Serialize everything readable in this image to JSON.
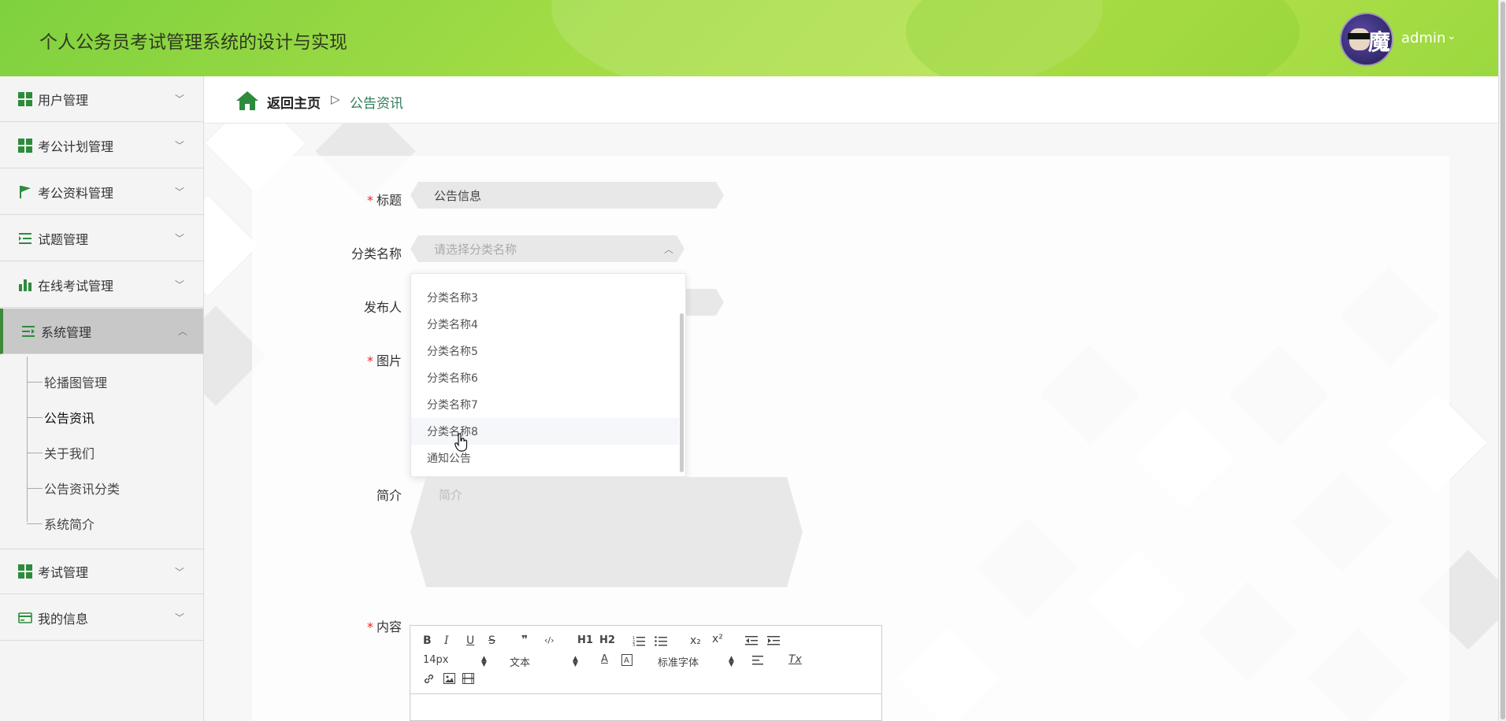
{
  "header": {
    "title": "个人公务员考试管理系统的设计与实现",
    "username": "admin",
    "avatar_glyph": "魔"
  },
  "sidebar": {
    "menus": [
      {
        "label": "用户管理",
        "icon": "grid-icon"
      },
      {
        "label": "考公计划管理",
        "icon": "grid-icon"
      },
      {
        "label": "考公资料管理",
        "icon": "flag-icon"
      },
      {
        "label": "试题管理",
        "icon": "list-indent-icon"
      },
      {
        "label": "在线考试管理",
        "icon": "bar-chart-icon"
      },
      {
        "label": "系统管理",
        "icon": "list-icon"
      },
      {
        "label": "考试管理",
        "icon": "grid-icon"
      },
      {
        "label": "我的信息",
        "icon": "card-icon"
      }
    ],
    "system_submenu": [
      {
        "label": "轮播图管理"
      },
      {
        "label": "公告资讯"
      },
      {
        "label": "关于我们"
      },
      {
        "label": "公告资讯分类"
      },
      {
        "label": "系统简介"
      }
    ]
  },
  "breadcrumb": {
    "home": "返回主页",
    "separator": "▷",
    "current": "公告资讯"
  },
  "form": {
    "title_label": "标题",
    "title_value": "公告信息",
    "category_label": "分类名称",
    "category_placeholder": "请选择分类名称",
    "publisher_label": "发布人",
    "image_label": "图片",
    "intro_label": "简介",
    "intro_placeholder": "简介",
    "content_label": "内容"
  },
  "dropdown": {
    "options": [
      "分类名称3",
      "分类名称4",
      "分类名称5",
      "分类名称6",
      "分类名称7",
      "分类名称8",
      "通知公告"
    ],
    "hovered": "分类名称8"
  },
  "editor": {
    "font_size": "14px",
    "text_type": "文本",
    "font_family": "标准字体",
    "buttons": [
      "B",
      "I",
      "U",
      "S",
      "❞",
      "‹/›",
      "H1",
      "H2",
      "ordered-list",
      "bullet-list",
      "x₂",
      "x²",
      "outdent",
      "indent",
      "A",
      "background",
      "align",
      "Tx",
      "link",
      "image",
      "video"
    ]
  },
  "colors": {
    "header_green": "#a3dc45",
    "accent_green": "#2e8b3c",
    "link_teal": "#2f7d5d",
    "required_red": "#e22222"
  }
}
